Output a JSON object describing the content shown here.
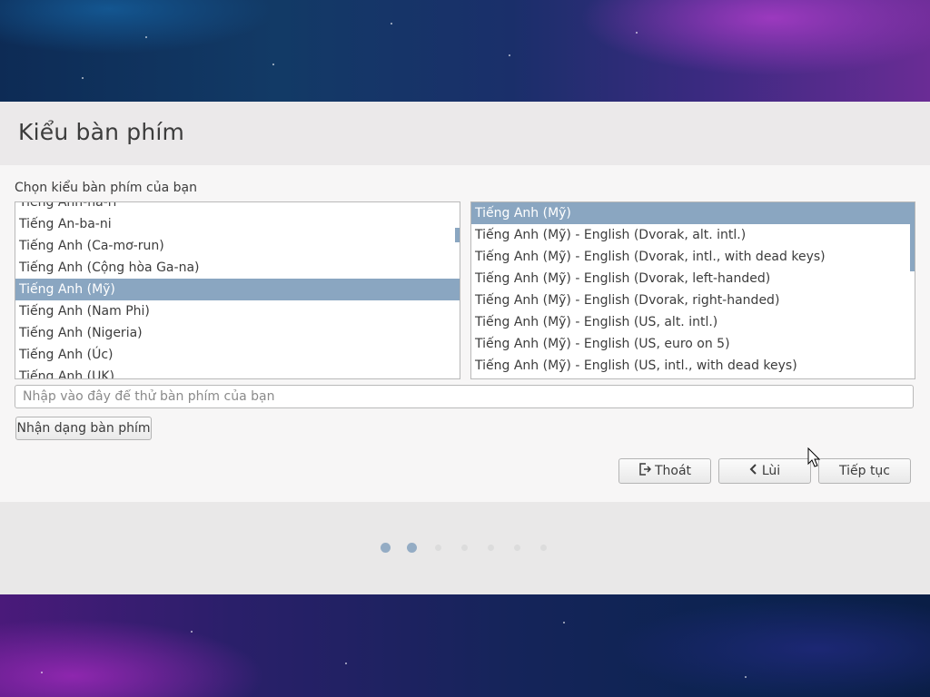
{
  "header": {
    "title": "Kiểu bàn phím"
  },
  "prompt": {
    "label": "Chọn kiểu bàn phím của bạn"
  },
  "layouts_list": {
    "items": [
      "Tiếng Anh-ha-ri",
      "Tiếng An-ba-ni",
      "Tiếng Anh (Ca-mơ-run)",
      "Tiếng Anh (Cộng hòa Ga-na)",
      "Tiếng Anh (Mỹ)",
      "Tiếng Anh (Nam Phi)",
      "Tiếng Anh (Nigeria)",
      "Tiếng Anh (Úc)",
      "Tiếng Anh (UK)"
    ],
    "selected": "Tiếng Anh (Mỹ)"
  },
  "variants_list": {
    "items": [
      "Tiếng Anh (Mỹ)",
      "Tiếng Anh (Mỹ) - English (Dvorak, alt. intl.)",
      "Tiếng Anh (Mỹ) - English (Dvorak, intl., with dead keys)",
      "Tiếng Anh (Mỹ) - English (Dvorak, left-handed)",
      "Tiếng Anh (Mỹ) - English (Dvorak, right-handed)",
      "Tiếng Anh (Mỹ) - English (US, alt. intl.)",
      "Tiếng Anh (Mỹ) - English (US, euro on 5)",
      "Tiếng Anh (Mỹ) - English (US, intl., with dead keys)"
    ],
    "selected": "Tiếng Anh (Mỹ)"
  },
  "test_input": {
    "placeholder": "Nhập vào đây để thử bàn phím của bạn",
    "value": ""
  },
  "buttons": {
    "detect": "Nhận dạng bàn phím",
    "quit": "Thoát",
    "back": "Lùi",
    "next": "Tiếp tục"
  },
  "progress": {
    "total_steps": 7,
    "current_step": 2
  },
  "colors": {
    "selection": "#8aa6c1",
    "dot_active": "#94acc4"
  }
}
